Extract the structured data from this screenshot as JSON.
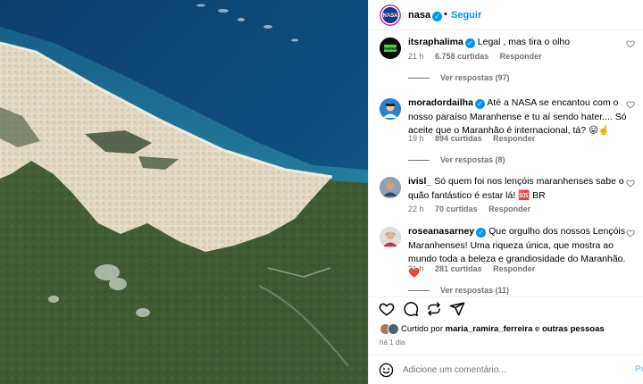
{
  "post": {
    "author": "nasa",
    "separator": "•",
    "follow_label": "Seguir",
    "image_alt_icon": "satellite-photo"
  },
  "comments": [
    {
      "user": "itsraphalima",
      "verified": true,
      "text": "Legal , mas tira o olho",
      "time": "21 h",
      "likes": "6.758 curtidas",
      "reply_label": "Responder",
      "replies": "Ver respostas (97)"
    },
    {
      "user": "moradordailha",
      "verified": true,
      "text": "Até a NASA se encantou com o nosso paraíso Maranhense e tu aí sendo hater.... Só aceite que o Maranhão é internacional, tá? 😛☝️",
      "time": "19 h",
      "likes": "894 curtidas",
      "reply_label": "Responder",
      "replies": "Ver respostas (8)"
    },
    {
      "user": "ivisl_",
      "verified": false,
      "text": "Só quem foi nos lençóis maranhenses sabe o quão fantástico é estar lá! 🆘 BR",
      "time": "22 h",
      "likes": "70 curtidas",
      "reply_label": "Responder",
      "replies": ""
    },
    {
      "user": "roseanasarney",
      "verified": true,
      "text": "Que orgulho dos nossos Lençóis Maranhenses! Uma riqueza única, que mostra ao mundo toda a beleza e grandiosidade do Maranhão. ❤️",
      "time": "21 h",
      "likes": "281 curtidas",
      "reply_label": "Responder",
      "replies": "Ver respostas (11)"
    }
  ],
  "liked_by": {
    "prefix": "Curtido por",
    "user": "maria_ramira_ferreira",
    "middle": "e",
    "others": "outras pessoas"
  },
  "time_ago": "há 1 dia",
  "add_comment": {
    "placeholder": "Adicione um comentário...",
    "post_label": "Po"
  },
  "colors": {
    "accent": "#0095f6",
    "muted": "#737373",
    "like_red": "#ed4956"
  }
}
